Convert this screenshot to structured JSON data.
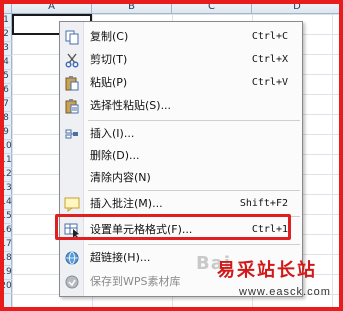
{
  "sheet": {
    "columns": [
      "A",
      "B",
      "C",
      "D"
    ],
    "rows": [
      "1",
      "2",
      "3",
      "4",
      "5",
      "6",
      "7",
      "8",
      "9",
      "10",
      "11",
      "12",
      "13",
      "14",
      "15",
      "16",
      "17",
      "18",
      "19",
      "20"
    ]
  },
  "menu": {
    "items": [
      {
        "label": "复制(C)",
        "shortcut": "Ctrl+C",
        "icon": "copy-icon",
        "enabled": true
      },
      {
        "label": "剪切(T)",
        "shortcut": "Ctrl+X",
        "icon": "scissors-icon",
        "enabled": true
      },
      {
        "label": "粘贴(P)",
        "shortcut": "Ctrl+V",
        "icon": "paste-icon",
        "enabled": true
      },
      {
        "label": "选择性粘贴(S)...",
        "shortcut": "",
        "icon": "paste-special-icon",
        "enabled": true
      },
      {
        "label": "插入(I)...",
        "shortcut": "",
        "icon": "insert-icon",
        "enabled": true
      },
      {
        "label": "删除(D)...",
        "shortcut": "",
        "icon": "",
        "enabled": true
      },
      {
        "label": "清除内容(N)",
        "shortcut": "",
        "icon": "",
        "enabled": true
      },
      {
        "label": "插入批注(M)...",
        "shortcut": "Shift+F2",
        "icon": "comment-icon",
        "enabled": true
      },
      {
        "label": "设置单元格格式(F)...",
        "shortcut": "Ctrl+1",
        "icon": "format-cells-icon",
        "enabled": true
      },
      {
        "label": "超链接(H)...",
        "shortcut": "",
        "icon": "hyperlink-icon",
        "enabled": true
      },
      {
        "label": "保存到WPS素材库",
        "shortcut": "",
        "icon": "save-library-icon",
        "enabled": false
      }
    ]
  },
  "watermark": {
    "brand": "Bai",
    "site_name": "易采站长站",
    "url": "www.easck.com"
  },
  "colors": {
    "highlight": "#e02020",
    "frame": "#e81c1c",
    "watermark_text": "#d21919"
  }
}
